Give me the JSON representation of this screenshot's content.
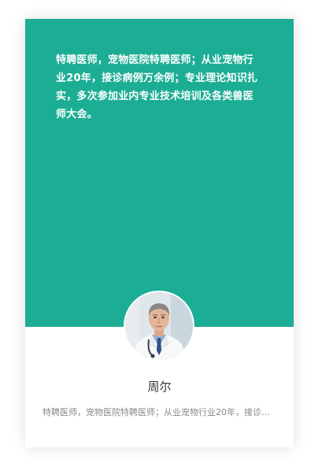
{
  "doctor": {
    "bio": "特聘医师，宠物医院特聘医师；从业宠物行业20年，接诊病例万余例；专业理论知识扎实，多次参加业内专业技术培训及各类兽医师大会。",
    "name": "周尔",
    "summary": "特聘医师，宠物医院特聘医师；从业宠物行业20年，接诊病例万余例；专业理论知识扎实，多次参加业内专业技术培训及各类兽医师大会。"
  },
  "colors": {
    "accent": "#1cad95"
  },
  "icons": {
    "avatar": "doctor-portrait"
  }
}
